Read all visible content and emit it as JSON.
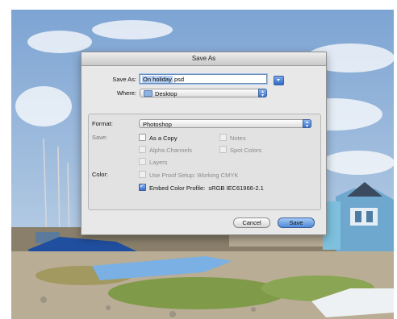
{
  "dialog": {
    "title": "Save As",
    "save_as_label": "Save As:",
    "filename_selected": "On holiday",
    "filename_ext": ".psd",
    "where_label": "Where:",
    "where_value": "Desktop",
    "format_label": "Format:",
    "format_value": "Photoshop",
    "save_label": "Save:",
    "options": {
      "as_a_copy": "As a Copy",
      "notes": "Notes",
      "alpha_channels": "Alpha Channels",
      "spot_colors": "Spot Colors",
      "layers": "Layers"
    },
    "color_label": "Color:",
    "use_proof_setup": "Use Proof Setup:",
    "proof_value": "Working CMYK",
    "embed_color_profile": "Embed Color Profile:",
    "profile_value": "sRGB IEC61966-2.1",
    "cancel_label": "Cancel",
    "save_button_label": "Save"
  },
  "icons": {
    "folder": "folder-icon",
    "disclosure": "disclosure-triangle-icon",
    "popup_arrows": "popup-arrows-icon",
    "checkmark": "checkmark-icon"
  },
  "colors": {
    "accent": "#3a72cf",
    "dialog_bg": "#e8e8e8"
  }
}
